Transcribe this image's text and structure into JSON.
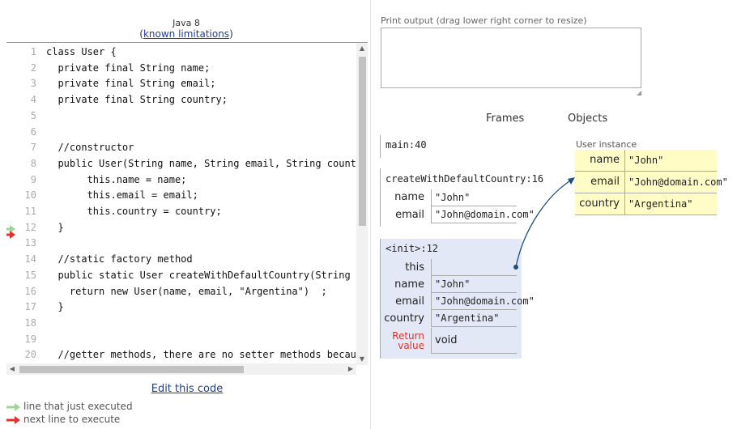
{
  "header": {
    "language": "Java 8",
    "limitations_open": "(",
    "limitations_link": "known limitations",
    "limitations_close": ")"
  },
  "code": {
    "lines": [
      {
        "num": "1",
        "text": "class User {"
      },
      {
        "num": "2",
        "text": "  private final String name;"
      },
      {
        "num": "3",
        "text": "  private final String email;"
      },
      {
        "num": "4",
        "text": "  private final String country;"
      },
      {
        "num": "5",
        "text": ""
      },
      {
        "num": "6",
        "text": ""
      },
      {
        "num": "7",
        "text": "  //constructor"
      },
      {
        "num": "8",
        "text": "  public User(String name, String email, String country"
      },
      {
        "num": "9",
        "text": "       this.name = name;"
      },
      {
        "num": "10",
        "text": "       this.email = email;"
      },
      {
        "num": "11",
        "text": "       this.country = country;"
      },
      {
        "num": "12",
        "text": "  }"
      },
      {
        "num": "13",
        "text": ""
      },
      {
        "num": "14",
        "text": "  //static factory method"
      },
      {
        "num": "15",
        "text": "  public static User createWithDefaultCountry(String na"
      },
      {
        "num": "16",
        "text": "    return new User(name, email, \"Argentina\")  ;"
      },
      {
        "num": "17",
        "text": "  }"
      },
      {
        "num": "18",
        "text": ""
      },
      {
        "num": "19",
        "text": ""
      },
      {
        "num": "20",
        "text": "  //getter methods, there are no setter methods because"
      }
    ],
    "just_executed_line": "12",
    "next_line": "12",
    "colors": {
      "just_executed": "#a0d39b",
      "next_line": "#e0322e"
    }
  },
  "controls": {
    "edit_link": "Edit this code"
  },
  "legend": {
    "just_executed": "line that just executed",
    "next_line": "next line to execute"
  },
  "output": {
    "label": "Print output (drag lower right corner to resize)",
    "content": ""
  },
  "viz": {
    "frames_header": "Frames",
    "objects_header": "Objects",
    "frames": [
      {
        "name": "main:40",
        "vars": []
      },
      {
        "name": "createWithDefaultCountry:16",
        "vars": [
          {
            "name": "name",
            "value": "\"John\""
          },
          {
            "name": "email",
            "value": "\"John@domain.com\""
          }
        ]
      },
      {
        "name": "<init>:12",
        "vars": [
          {
            "name": "this",
            "value": ""
          },
          {
            "name": "name",
            "value": "\"John\""
          },
          {
            "name": "email",
            "value": "\"John@domain.com\""
          },
          {
            "name": "country",
            "value": "\"Argentina\""
          },
          {
            "name": "Return value",
            "value": "void"
          }
        ]
      }
    ],
    "return_label_line1": "Return",
    "return_label_line2": "value",
    "object": {
      "label": "User instance",
      "fields": [
        {
          "key": "name",
          "value": "\"John\""
        },
        {
          "key": "email",
          "value": "\"John@domain.com\""
        },
        {
          "key": "country",
          "value": "\"Argentina\""
        }
      ]
    },
    "colors": {
      "active_frame": "#e2e8f5",
      "object_bg": "#fffcc6",
      "pointer": "#1f4f7f",
      "return_label": "#e0322e"
    }
  }
}
